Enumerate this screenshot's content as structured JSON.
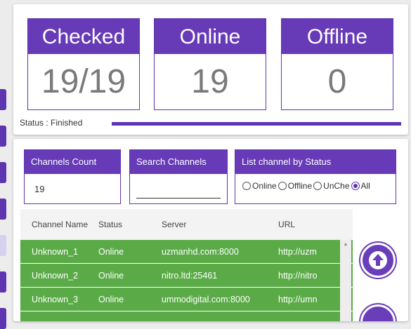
{
  "stats": {
    "checked": {
      "label": "Checked",
      "value": "19/19"
    },
    "online": {
      "label": "Online",
      "value": "19"
    },
    "offline": {
      "label": "Offline",
      "value": "0"
    }
  },
  "status": {
    "text": "Status : Finished",
    "progress_fraction": 1.0
  },
  "filters": {
    "count": {
      "label": "Channels Count",
      "value": "19"
    },
    "search": {
      "label": "Search Channels",
      "value": "",
      "placeholder": ""
    },
    "by_status": {
      "label": "List channel by Status",
      "options": [
        {
          "label": "Online",
          "checked": false
        },
        {
          "label": "Offline",
          "checked": false
        },
        {
          "label": "UnChe",
          "checked": false
        },
        {
          "label": "All",
          "checked": true
        }
      ]
    }
  },
  "table": {
    "columns": [
      "Channel Name",
      "Status",
      "Server",
      "URL"
    ],
    "rows": [
      {
        "name": "Unknown_1",
        "status": "Online",
        "server": "uzmanhd.com:8000",
        "url": "http://uzm"
      },
      {
        "name": "Unknown_2",
        "status": "Online",
        "server": "nitro.ltd:25461",
        "url": "http://nitro"
      },
      {
        "name": "Unknown_3",
        "status": "Online",
        "server": "ummodigital.com:8000",
        "url": "http://umn"
      },
      {
        "name": "",
        "status": "",
        "server": "",
        "url": ""
      }
    ]
  },
  "colors": {
    "accent": "#673ab7",
    "online_row": "#5aab47"
  },
  "icons": {
    "scroll_up_button": "arrow-up-icon",
    "scrollbar_up": "caret-up-icon"
  }
}
